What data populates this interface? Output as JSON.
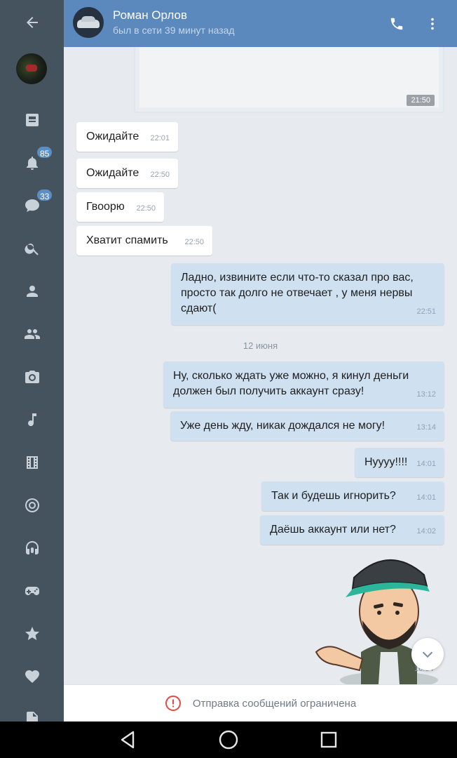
{
  "header": {
    "contact_name": "Роман Орлов",
    "status": "был в сети 39 минут назад",
    "back_icon": "arrow-left-icon",
    "call_icon": "phone-icon",
    "menu_icon": "more-vertical-icon"
  },
  "rail": {
    "items": [
      {
        "name": "news",
        "icon": "newspaper-icon"
      },
      {
        "name": "notifications",
        "icon": "bell-icon",
        "badge": "85"
      },
      {
        "name": "messages",
        "icon": "chat-bubble-icon",
        "badge": "33"
      },
      {
        "name": "search",
        "icon": "search-icon"
      },
      {
        "name": "friends",
        "icon": "user-icon"
      },
      {
        "name": "groups",
        "icon": "users-icon"
      },
      {
        "name": "photos",
        "icon": "camera-icon"
      },
      {
        "name": "music",
        "icon": "music-note-icon"
      },
      {
        "name": "videos",
        "icon": "film-icon"
      },
      {
        "name": "live",
        "icon": "target-icon"
      },
      {
        "name": "podcasts",
        "icon": "headphones-icon"
      },
      {
        "name": "games",
        "icon": "gamepad-icon"
      },
      {
        "name": "bookmarks",
        "icon": "star-icon"
      },
      {
        "name": "favorites",
        "icon": "heart-icon"
      },
      {
        "name": "documents",
        "icon": "document-icon"
      }
    ]
  },
  "forwarded_card": {
    "time": "21:50"
  },
  "messages": [
    {
      "dir": "in",
      "text": "Ожидайте",
      "time": "22:01"
    },
    {
      "dir": "in",
      "text": "Ожидайте",
      "time": "22:50"
    },
    {
      "dir": "in",
      "text": "Гвоорю",
      "time": "22:50"
    },
    {
      "dir": "in",
      "text": "Хватит спамить",
      "time": "22:50"
    },
    {
      "dir": "out",
      "text": "Ладно, извините если что-то сказал про вас, просто так долго не отвечает , у меня нервы сдают(",
      "time": "22:51"
    },
    {
      "dir": "out",
      "text": "Ну, сколько ждать уже можно, я кинул деньги должен был получить аккаунт сразу!",
      "time": "13:12"
    },
    {
      "dir": "out",
      "text": "Уже день жду, никак дождался не могу!",
      "time": "13:14"
    },
    {
      "dir": "out",
      "text": "Нуууу!!!!",
      "time": "14:01"
    },
    {
      "dir": "out",
      "text": "Так и будешь игнорить?",
      "time": "14:01"
    },
    {
      "dir": "out",
      "text": "Даёшь аккаунт или нет?",
      "time": "14:02"
    }
  ],
  "date_separator": "12 июня",
  "sticker": {
    "time": "16:34"
  },
  "footer": {
    "text": "Отправка сообщений ограничена",
    "icon": "alert-circle-icon",
    "icon_color": "#e64646"
  },
  "colors": {
    "header": "#5b88bd",
    "rail": "#45535f",
    "incoming": "#ffffff",
    "outgoing": "#cfe0f0",
    "background": "#e7ebf0"
  }
}
